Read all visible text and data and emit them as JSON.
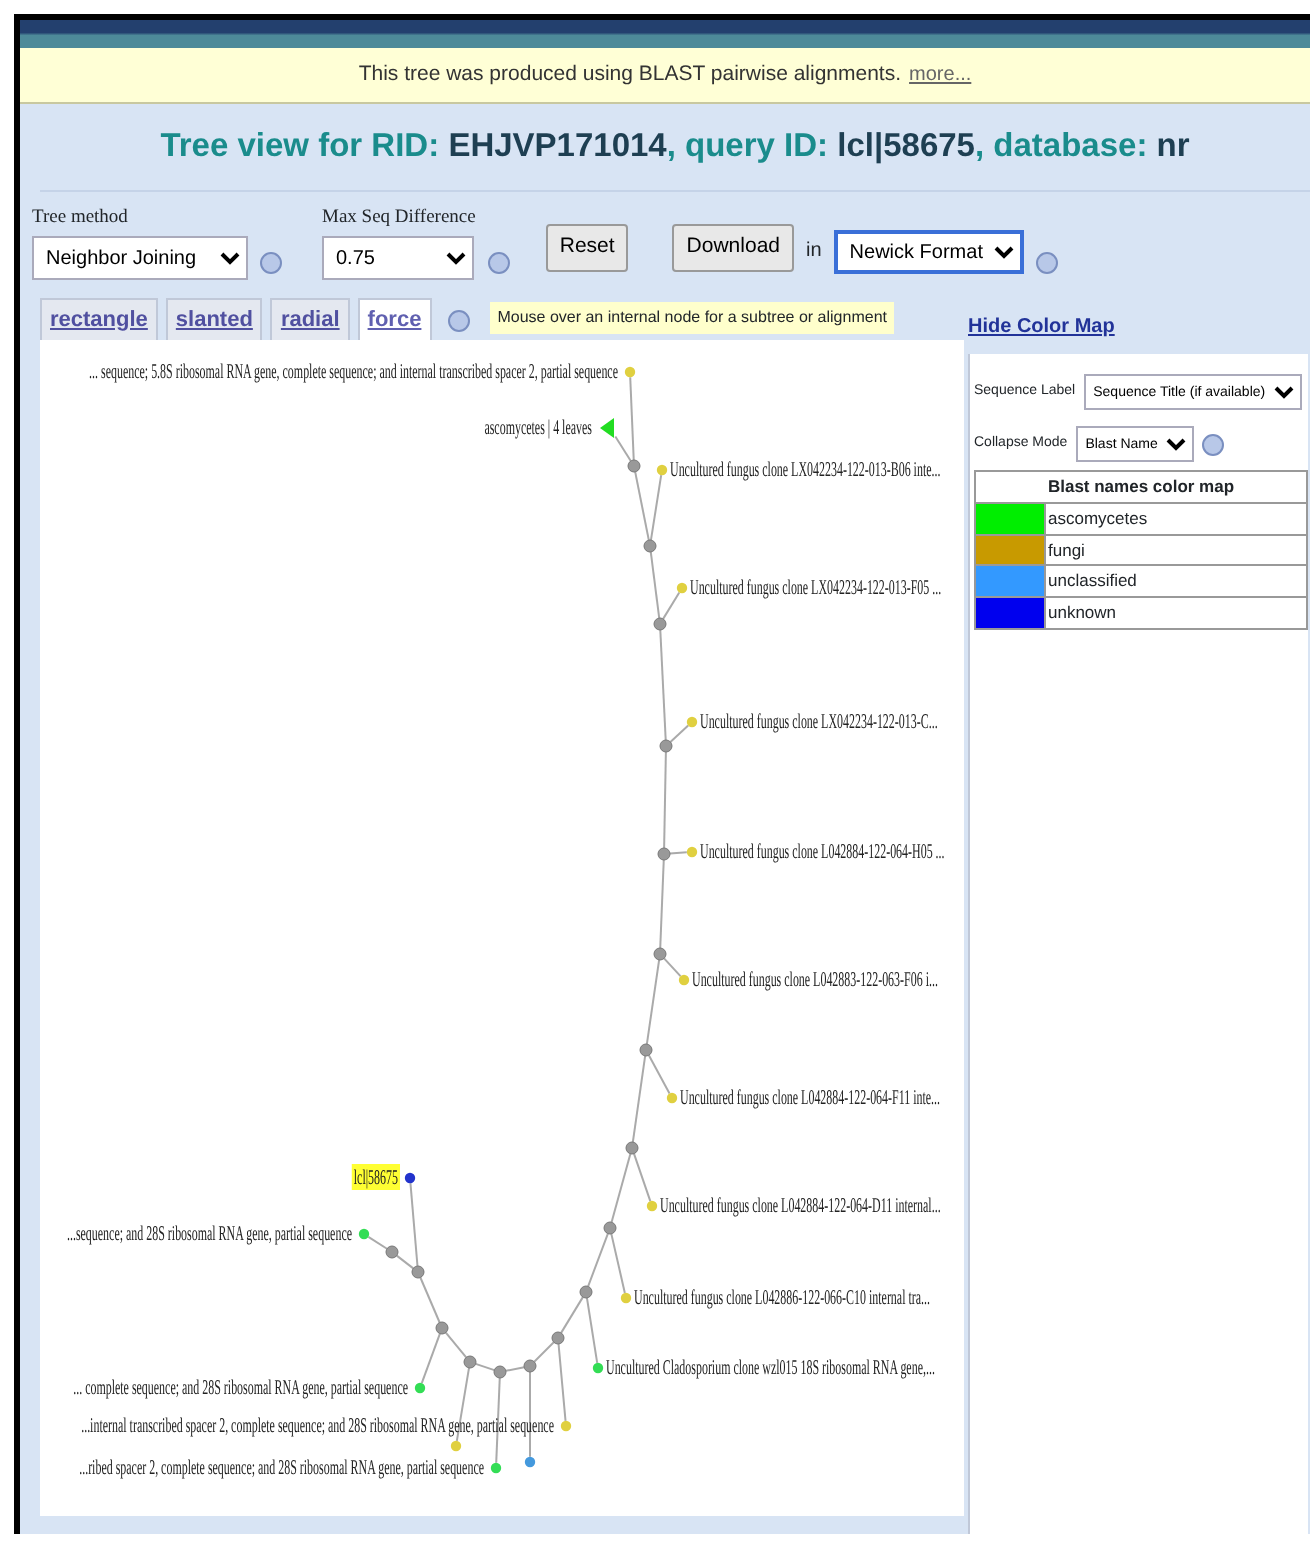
{
  "banner": {
    "text": "This tree was produced using BLAST pairwise alignments.",
    "link": "more..."
  },
  "title": [
    {
      "kind": "label",
      "text": "Tree view for RID: "
    },
    {
      "kind": "value",
      "text": "EHJVP171014"
    },
    {
      "kind": "label",
      "text": ", query ID: "
    },
    {
      "kind": "value",
      "text": "lcl|58675"
    },
    {
      "kind": "label",
      "text": ", database: "
    },
    {
      "kind": "value",
      "text": "nr"
    }
  ],
  "controls": {
    "tree_method": {
      "label": "Tree method",
      "value": "Neighbor Joining"
    },
    "max_seq_difference": {
      "label": "Max Seq Difference",
      "value": "0.75"
    },
    "reset_button": "Reset",
    "download_button": "Download",
    "format_prefix": "in",
    "format": {
      "value": "Newick Format",
      "focused": true
    }
  },
  "tabs": [
    {
      "label": "rectangle",
      "selected": false
    },
    {
      "label": "slanted",
      "selected": false
    },
    {
      "label": "radial",
      "selected": false
    },
    {
      "label": "force",
      "selected": true
    }
  ],
  "hint": "Mouse over an internal node for a subtree or alignment",
  "tree": {
    "leaves": [
      {
        "kind": "leaf",
        "label": "... sequence; 5.8S ribosomal RNA gene, complete sequence; and internal transcribed spacer 2, partial sequence",
        "color": "#e0d040"
      },
      {
        "kind": "collapsed",
        "label": "ascomycetes | 4 leaves",
        "color": "#22dd22"
      },
      {
        "kind": "leaf",
        "label": "Uncultured fungus clone LX042234-122-013-B06 inte...",
        "color": "#e0d040"
      },
      {
        "kind": "leaf",
        "label": "Uncultured fungus clone LX042234-122-013-F05 ...",
        "color": "#e0d040"
      },
      {
        "kind": "leaf",
        "label": "Uncultured fungus clone LX042234-122-013-C...",
        "color": "#e0d040"
      },
      {
        "kind": "leaf",
        "label": "Uncultured fungus clone L042884-122-064-H05 ...",
        "color": "#e0d040"
      },
      {
        "kind": "leaf",
        "label": "Uncultured fungus clone L042883-122-063-F06 i...",
        "color": "#e0d040"
      },
      {
        "kind": "leaf",
        "label": "Uncultured fungus clone L042884-122-064-F11 inte...",
        "color": "#e0d040"
      },
      {
        "kind": "leaf",
        "label": "Uncultured fungus clone L042884-122-064-D11 internal...",
        "color": "#e0d040"
      },
      {
        "kind": "leaf",
        "label": "Uncultured fungus clone L042886-122-066-C10 internal tra...",
        "color": "#e0d040"
      },
      {
        "kind": "leaf",
        "label": "Uncultured Cladosporium clone wzl015 18S ribosomal RNA gene,...",
        "color": "#33dd55"
      },
      {
        "kind": "query",
        "label": "lcl|58675",
        "color": "#2233cc"
      },
      {
        "kind": "leaf",
        "label": "...sequence; and 28S ribosomal RNA gene, partial sequence",
        "color": "#33dd55"
      },
      {
        "kind": "leaf",
        "label": "... complete sequence; and 28S ribosomal RNA gene, partial sequence",
        "color": "#33dd55"
      },
      {
        "kind": "leaf",
        "label": "...internal transcribed spacer 2, complete sequence; and 28S ribosomal RNA gene, partial sequence",
        "color": "#e0d040"
      },
      {
        "kind": "leaf",
        "color": "#e0d040"
      },
      {
        "kind": "leaf",
        "color": "#4499dd"
      },
      {
        "kind": "leaf",
        "label": "...ribed spacer 2, complete sequence; and 28S ribosomal RNA gene, partial sequence",
        "color": "#33dd55"
      }
    ]
  },
  "color_map_panel": {
    "toggle_link": "Hide Color Map",
    "sequence_label": {
      "label": "Sequence Label",
      "value": "Sequence Title (if available)"
    },
    "collapse_mode": {
      "label": "Collapse Mode",
      "value": "Blast Name"
    },
    "table": {
      "title": "Blast names color map",
      "rows": [
        {
          "name": "ascomycetes",
          "color": "#00ee00"
        },
        {
          "name": "fungi",
          "color": "#c89a00"
        },
        {
          "name": "unclassified",
          "color": "#3399ff"
        },
        {
          "name": "unknown",
          "color": "#0000ee"
        }
      ]
    }
  }
}
